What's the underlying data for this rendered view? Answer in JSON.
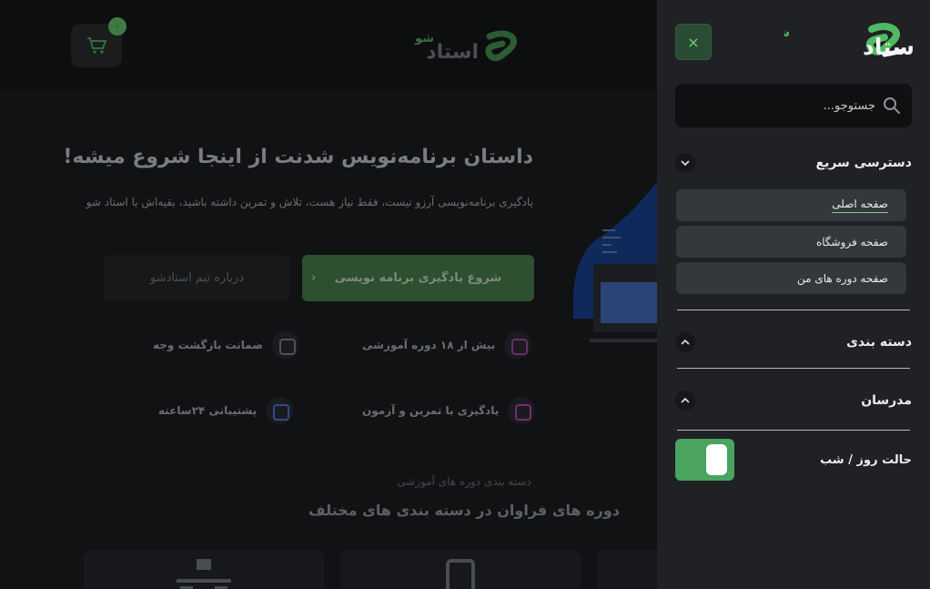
{
  "brand": {
    "name": "استاد",
    "tagline": "شو",
    "accent": "#4aa35e"
  },
  "header": {
    "cart_count": "۰"
  },
  "hero": {
    "title": "داستان برنامه‌نویس شدنت از اینجا شروع میشه!",
    "subtitle": "یادگیری برنامه‌نویسی آرزو نیست، فقط نیاز هست، تلاش و تمرین داشته باشید، بقیه‌اش با استاد شو",
    "primary_button": "شروع یادگیری برنامه نویسی",
    "secondary_button": "درباره تیم استادشو",
    "features": [
      {
        "label": "بیش از ۱۸ دوره آموزشی",
        "icon": "graduation-cap-icon",
        "color": "#a53ca0"
      },
      {
        "label": "ضمانت بازگشت وجه",
        "icon": "wallet-icon",
        "color": "#5b5e61"
      },
      {
        "label": "یادگیری با تمرین و آزمون",
        "icon": "edit-icon",
        "color": "#a53ca0"
      },
      {
        "label": "پشتیبانی ۲۴ساعته",
        "icon": "phone-icon",
        "color": "#3a5fb0"
      }
    ]
  },
  "categories_section": {
    "kicker": "دسته بندی دوره های آموزشی",
    "title": "دوره های فراوان در دسته بندی های مختلف"
  },
  "drawer": {
    "close_label": "×",
    "search_placeholder": "جستوجو...",
    "quick_access": {
      "title": "دسترسی سریع",
      "items": [
        {
          "label": "صفحه اصلی",
          "active": true
        },
        {
          "label": "صفحه فروشگاه",
          "active": false
        },
        {
          "label": "صفحه دوره های من",
          "active": false
        }
      ]
    },
    "categories_title": "دسته بندی",
    "teachers_title": "مدرسان",
    "theme_toggle": {
      "label": "حالت روز / شب",
      "on": true
    }
  }
}
